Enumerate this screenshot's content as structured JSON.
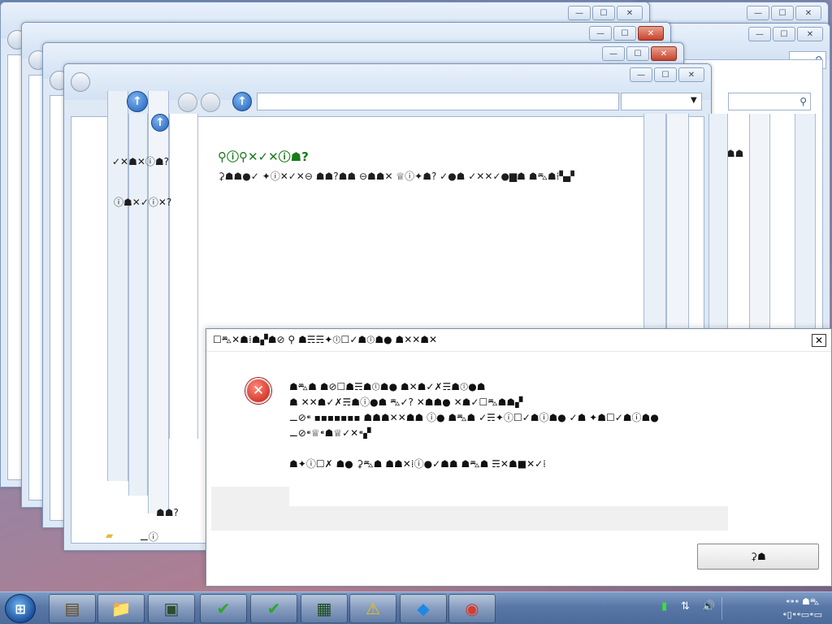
{
  "windows": {
    "caption_min": "—",
    "caption_max": "☐",
    "caption_close": "✕"
  },
  "explorer": {
    "sidebar_row1": "☗⛍☗✓✕☗☗",
    "sidebar_row2": "ⓘ✕✓✕ⓘ",
    "strip_row1": "✓✕☗✕ⓘ☗?",
    "strip_row2": "ⓘ☗✕✓ⓘ✕?",
    "strip_row3": "☗☗?",
    "strip_row4": "⚊ⓘ",
    "right_row1": "☗⛍☗☗☗",
    "left_bottom": "⚊ ⓘ☗☗",
    "heading": "⚲ⓘ⚲✕✓✕ⓘ☗?",
    "subheading": "⚳☗☗●✓ ✦ⓘ✕✓✕⊖ ☗☗?☗☗ ⊖☗☗✕ ♕ⓘ✦☗? ✓●☗ ✓✕✕✓●▆☗ ☗⛍☗⁞▚▞",
    "search_icon": "⚲"
  },
  "dialog": {
    "title": "☐⛍✕☗⁞☗▞☗⊘ ⚲ ☗☴☴✦ⓘ☐✓☗ⓘ☗● ☗✕✕☗✕",
    "close_label": "✕",
    "error_icon_label": "✕",
    "line1": "☗⛍☗ ☗⊘☐☗☴☗ⓘ☗● ☗✕☗✓✗☴☗ⓘ●☗",
    "line2": "☗ ✕✕☗✓✗☴☗ⓘ●☗ ⛍✓? ✕☗☗● ✕☗✓☐⛍☗☗▞",
    "line3": "⚊⊘⁌ ▪▪▪▪▪▪▪ ☗☗☗✕✕☗☗ ⓘ● ☗⛍☗ ✓☴✦ⓘ☐✓☗ⓘ☗● ✓☗ ✦☗☐✓☗ⓘ☗●",
    "line4": "⚊⊘⁌♕⁌☗♕✓✕⁌▞",
    "line5": "☗✦ⓘ☐✗ ☗● ⚳⛍☗ ☗☗✕⁞ⓘ●✓☗☗ ☗⛍☗ ☴✕☗■✕✓⁞",
    "ok_label": "⚳☗"
  },
  "taskbar": {
    "start_label": "⊞",
    "buttons": [
      {
        "name": "tb-archive",
        "icon": "▤"
      },
      {
        "name": "tb-explorer",
        "icon": "📁"
      },
      {
        "name": "tb-notes",
        "icon": "▣"
      },
      {
        "name": "tb-checkmark-1",
        "icon": "✔"
      },
      {
        "name": "tb-checkmark-2",
        "icon": "✔"
      },
      {
        "name": "tb-monitor",
        "icon": "▦"
      },
      {
        "name": "tb-warning",
        "icon": "⚠"
      },
      {
        "name": "tb-cube",
        "icon": "◆"
      },
      {
        "name": "tb-chrome",
        "icon": "◉"
      }
    ],
    "tray_network": "⇅",
    "tray_volume": "🔊",
    "tray_flag": "▮",
    "clock_line1": "⁌⁍⁌ ☗⛍",
    "clock_line2": "⁌▯⁌⁌▭⁌▭"
  },
  "colors": {
    "accent": "#1f5fb8",
    "error": "#c41a0f",
    "check_green": "#1a7a1a"
  }
}
